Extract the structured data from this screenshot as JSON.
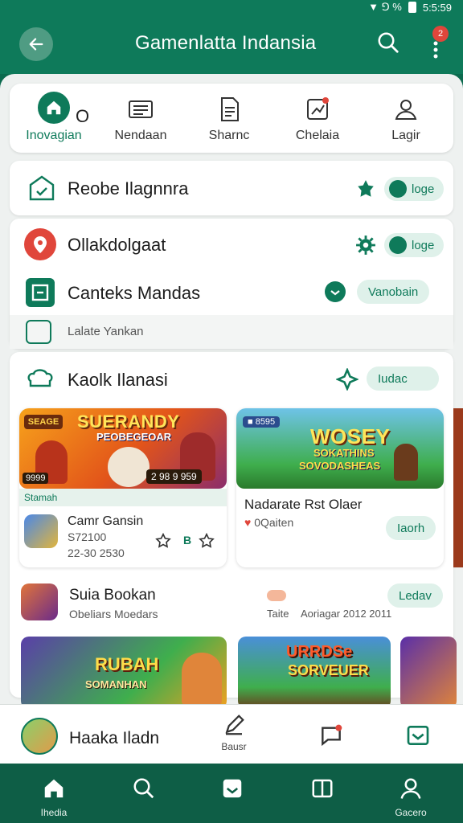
{
  "status_bar": {
    "time": "5:5:59",
    "icons": "▼ ⅁ %"
  },
  "app_bar": {
    "title": "Gamenlatta Indansia"
  },
  "tabs": {
    "zero": "O",
    "items": [
      {
        "label": "Inovagian",
        "icon": "home-icon"
      },
      {
        "label": "Nendaan",
        "icon": "news-icon"
      },
      {
        "label": "Sharnc",
        "icon": "document-icon"
      },
      {
        "label": "Chelaia",
        "icon": "chart-icon"
      },
      {
        "label": "Lagir",
        "icon": "user-icon"
      }
    ]
  },
  "rows": {
    "row1": {
      "title": "Reobe Ilagnnra",
      "pill": "loge"
    },
    "row2": {
      "title": "Ollakdolgaat",
      "pill": "loge"
    },
    "row3": {
      "title": "Canteks Mandas",
      "pill": "Vanobain"
    },
    "row4": {
      "title": "Lalate Yankan"
    },
    "row5": {
      "title": "Kaolk Ilanasi",
      "pill": "Iudac"
    }
  },
  "game1": {
    "banner_title": "SUERANDY",
    "banner_sub": "PEOBEGEOAR",
    "banner_tag": "SEAGE",
    "banner_left_tag": "9999",
    "banner_right_tag": "2 98  9 959",
    "strip": "Stamah",
    "name": "Camr Gansin",
    "price": "S72100",
    "date": "22-30  2530",
    "rating": "B"
  },
  "game2": {
    "banner_title": "WOSEY",
    "banner_sub": "SOKATHINS",
    "banner_sub2": "SOVODASHEAS",
    "banner_tag": "■ 8595",
    "name": "Nadarate Rst Olaer",
    "sub": "0Qaiten",
    "button": "Iaorh"
  },
  "featured": {
    "name": "Suia Bookan",
    "sub": "Obeliars Moedars",
    "tag": "Taite",
    "date": "Aoriagar 2012 2011",
    "button": "Ledav"
  },
  "game3": {
    "title": "RUBAH",
    "sub": "SOMANHAN"
  },
  "game4": {
    "title": "URRDSe",
    "sub": "SORVEUER"
  },
  "bottom_row": {
    "user": "Haaka Iladn",
    "label": "Bausr"
  },
  "nav": {
    "items": [
      {
        "label": "Ihedia",
        "icon": "home-icon"
      },
      {
        "label": "",
        "icon": "search-icon"
      },
      {
        "label": "",
        "icon": "inbox-icon"
      },
      {
        "label": "",
        "icon": "book-icon"
      },
      {
        "label": "Gacero",
        "icon": "profile-icon"
      }
    ]
  },
  "colors": {
    "primary": "#0e7a5a",
    "nav": "#0e5e46",
    "accent_red": "#e0463b",
    "pill_bg": "#dff1ea"
  }
}
